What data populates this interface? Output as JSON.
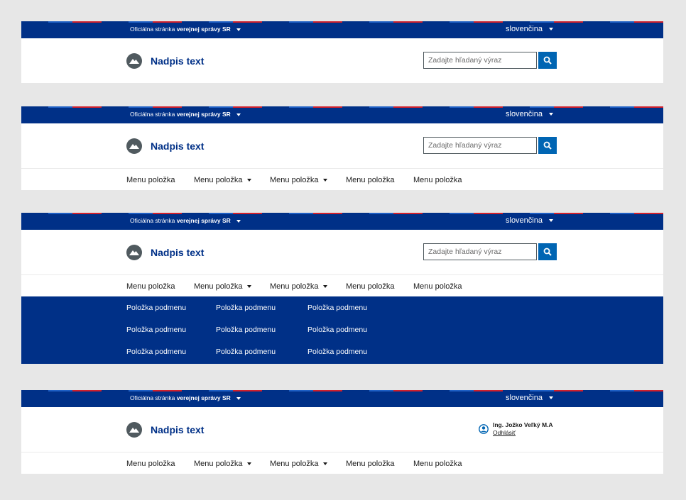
{
  "gov_bar": {
    "official_prefix": "Oficiálna stránka",
    "official_bold": "verejnej správy SR",
    "language": "slovenčina"
  },
  "site": {
    "title": "Nadpis text"
  },
  "search": {
    "placeholder": "Zadajte hľadaný výraz"
  },
  "nav": {
    "items": [
      {
        "label": "Menu položka"
      },
      {
        "label": "Menu položka"
      },
      {
        "label": "Menu položka"
      },
      {
        "label": "Menu položka"
      },
      {
        "label": "Menu položka"
      }
    ]
  },
  "submenu": {
    "rows": [
      [
        "Položka podmenu",
        "Položka podmenu",
        "Položka podmenu"
      ],
      [
        "Položka podmenu",
        "Položka podmenu",
        "Položka podmenu"
      ],
      [
        "Položka podmenu",
        "Položka podmenu",
        "Položka podmenu"
      ]
    ]
  },
  "user": {
    "name": "Ing. Jožko Veľký M.A",
    "logout": "Odhlásiť"
  },
  "colors": {
    "gov_blue": "#003087",
    "accent_blue": "#0065b3",
    "stripe_red": "#d0202c",
    "logo_gray": "#505a5f"
  },
  "icons": {
    "logo": "mountain-logo-icon",
    "search": "search-icon",
    "caret": "caret-down-icon",
    "user": "user-circle-icon"
  }
}
